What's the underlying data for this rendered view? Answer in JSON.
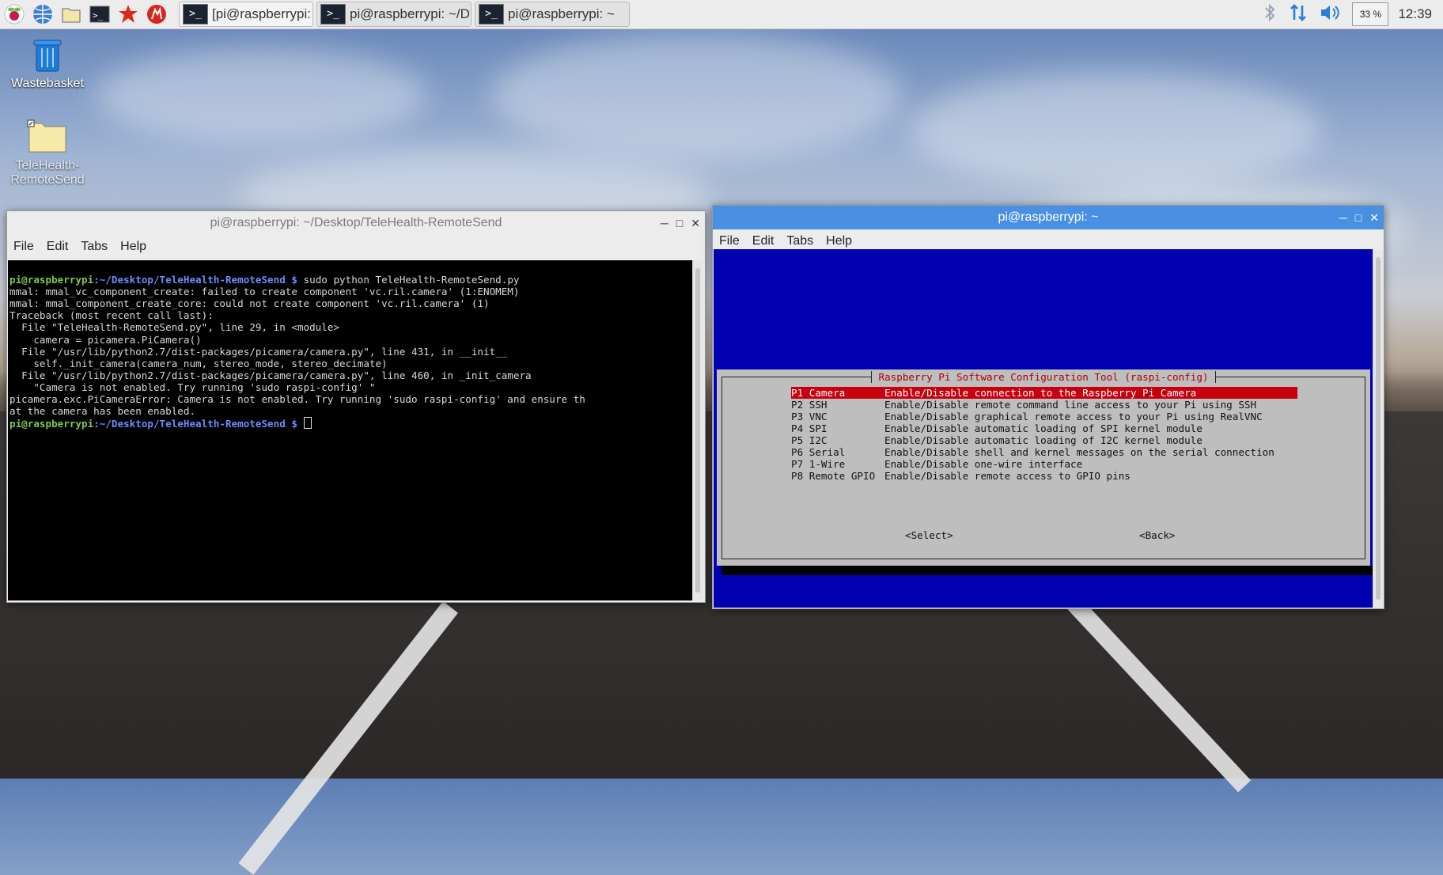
{
  "taskbar": {
    "launchers": [
      "raspberry-menu-icon",
      "web-browser-icon",
      "file-manager-icon",
      "terminal-icon",
      "mathematica-icon",
      "wolfram-icon"
    ],
    "tasks": [
      {
        "label": "[pi@raspberrypi: ~]"
      },
      {
        "label": "pi@raspberrypi: ~/D..."
      },
      {
        "label": "pi@raspberrypi: ~"
      }
    ],
    "cpu": "33 %",
    "clock": "12:39"
  },
  "desktop": {
    "icons": [
      {
        "label": "Wastebasket"
      },
      {
        "label": "TeleHealth-RemoteSend"
      }
    ]
  },
  "left_window": {
    "title": "pi@raspberrypi: ~/Desktop/TeleHealth-RemoteSend",
    "menu": [
      "File",
      "Edit",
      "Tabs",
      "Help"
    ],
    "prompt_user": "pi@raspberrypi",
    "prompt_path": ":~/Desktop/TeleHealth-RemoteSend $",
    "command": " sudo python TeleHealth-RemoteSend.py",
    "lines": [
      "mmal: mmal_vc_component_create: failed to create component 'vc.ril.camera' (1:ENOMEM)",
      "mmal: mmal_component_create_core: could not create component 'vc.ril.camera' (1)",
      "Traceback (most recent call last):",
      "  File \"TeleHealth-RemoteSend.py\", line 29, in <module>",
      "    camera = picamera.PiCamera()",
      "  File \"/usr/lib/python2.7/dist-packages/picamera/camera.py\", line 431, in __init__",
      "    self._init_camera(camera_num, stereo_mode, stereo_decimate)",
      "  File \"/usr/lib/python2.7/dist-packages/picamera/camera.py\", line 460, in _init_camera",
      "    \"Camera is not enabled. Try running 'sudo raspi-config' \"",
      "picamera.exc.PiCameraError: Camera is not enabled. Try running 'sudo raspi-config' and ensure th",
      "at the camera has been enabled."
    ]
  },
  "right_window": {
    "title": "pi@raspberrypi: ~",
    "menu": [
      "File",
      "Edit",
      "Tabs",
      "Help"
    ],
    "dialog_title": "Raspberry Pi Software Configuration Tool (raspi-config)",
    "options": [
      {
        "key": "P1 Camera",
        "desc": "Enable/Disable connection to the Raspberry Pi Camera"
      },
      {
        "key": "P2 SSH",
        "desc": "Enable/Disable remote command line access to your Pi using SSH"
      },
      {
        "key": "P3 VNC",
        "desc": "Enable/Disable graphical remote access to your Pi using RealVNC"
      },
      {
        "key": "P4 SPI",
        "desc": "Enable/Disable automatic loading of SPI kernel module"
      },
      {
        "key": "P5 I2C",
        "desc": "Enable/Disable automatic loading of I2C kernel module"
      },
      {
        "key": "P6 Serial",
        "desc": "Enable/Disable shell and kernel messages on the serial connection"
      },
      {
        "key": "P7 1-Wire",
        "desc": "Enable/Disable one-wire interface"
      },
      {
        "key": "P8 Remote GPIO",
        "desc": "Enable/Disable remote access to GPIO pins"
      }
    ],
    "select_label": "<Select>",
    "back_label": "<Back>"
  },
  "colors": {
    "titlebar_active": "#4a90e2",
    "raspi_blue": "#0000b0",
    "selection_red": "#c8000e"
  }
}
